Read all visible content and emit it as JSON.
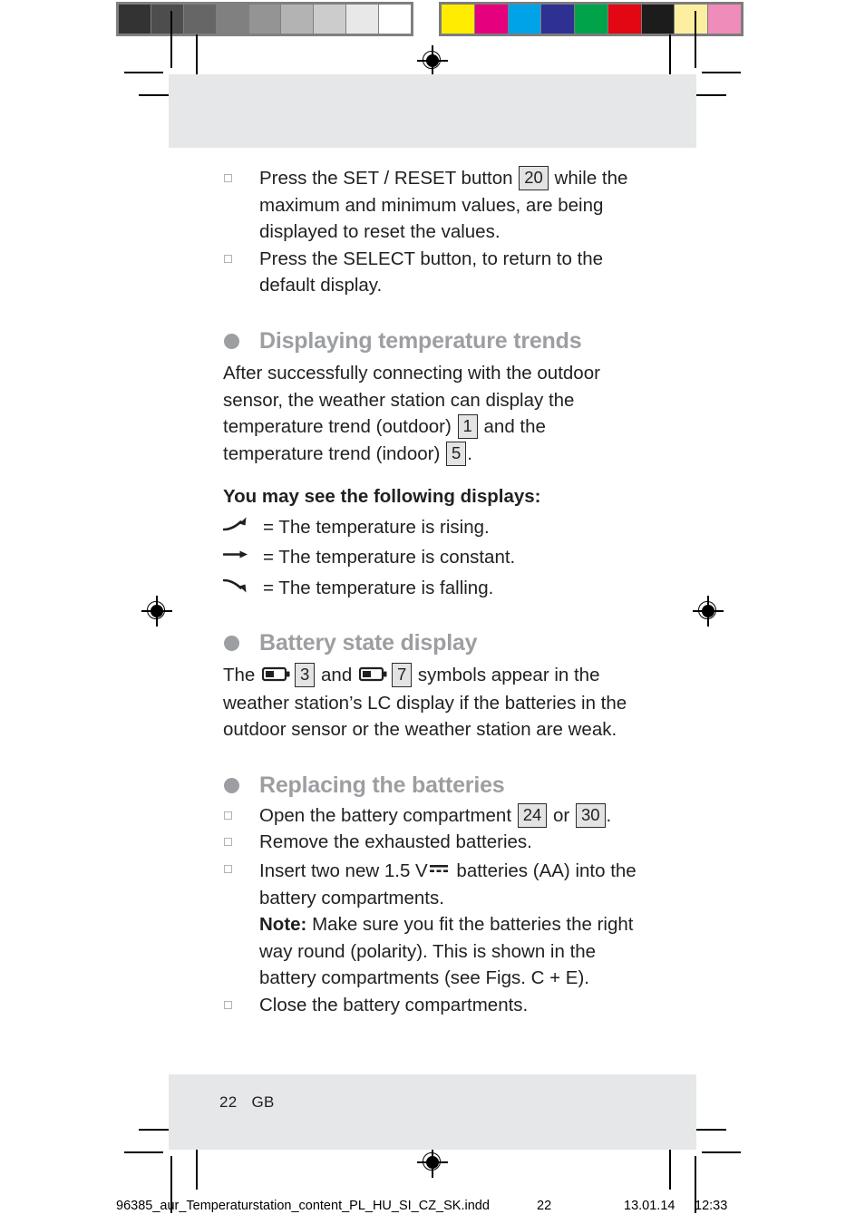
{
  "page": {
    "folio_number": "22",
    "folio_locale": "GB"
  },
  "color_bar": {
    "grays": [
      "#333333",
      "#4d4d4d",
      "#666666",
      "#808080",
      "#949494",
      "#b3b3b3",
      "#cccccc",
      "#e8e8e8",
      "#ffffff"
    ],
    "process": [
      "#ffec00",
      "#e5007d",
      "#00a2e8",
      "#2e3192",
      "#00a34a",
      "#e30613",
      "#1c1c1c",
      "#fcf0a0",
      "#f08cba"
    ]
  },
  "content": {
    "intro_steps": [
      "Press the SET / RESET button |20| while the maximum and minimum values, are being displayed to reset the values.",
      "Press the SELECT button, to return to the default display."
    ],
    "intro_step_1": {
      "pre": "Press the SET / RESET button ",
      "ref": "20",
      "post": " while the maximum and minimum values, are being displayed to reset the values."
    },
    "intro_step_2": "Press the SELECT button, to return to the default display.",
    "section_trends": {
      "heading": "Displaying temperature trends",
      "para_pre": "After successfully connecting with the outdoor sensor, the weather station can display the temperature trend (outdoor) ",
      "ref_outdoor": "1",
      "para_mid": " and the temperature trend (indoor) ",
      "ref_indoor": "5",
      "para_post": ".",
      "displays_heading": "You may see the following displays:",
      "trends": [
        {
          "icon": "arrow-rising-icon",
          "text": "= The temperature is rising."
        },
        {
          "icon": "arrow-constant-icon",
          "text": "= The temperature is constant."
        },
        {
          "icon": "arrow-falling-icon",
          "text": "= The temperature is falling."
        }
      ]
    },
    "section_battery_state": {
      "heading": "Battery state display",
      "para_pre": "The ",
      "ref_1": "3",
      "para_and": " and ",
      "ref_2": "7",
      "para_post": " symbols appear in the weather station’s LC display if the batteries in the outdoor sensor or the weather station are weak."
    },
    "section_replacing": {
      "heading": "Replacing the batteries",
      "step_open": {
        "pre": "Open the battery compartment ",
        "ref_1": "24",
        "mid": " or ",
        "ref_2": "30",
        "post": "."
      },
      "step_remove": "Remove the exhausted batteries.",
      "step_insert": {
        "pre": "Insert two new 1.5 V",
        "dc_symbol": "dc-voltage-icon",
        "post": " batteries (AA) into the battery compartments.",
        "note_label": "Note:",
        "note_text": " Make sure you fit the batteries the right way round (polarity). This is shown in the battery compartments (see Figs. C + E)."
      },
      "step_close": "Close the battery compartments."
    }
  },
  "imprint": {
    "file_name": "96385_aur_Temperaturstation_content_PL_HU_SI_CZ_SK.indd",
    "page_number": "22",
    "date": "13.01.14",
    "time": "12:33"
  }
}
